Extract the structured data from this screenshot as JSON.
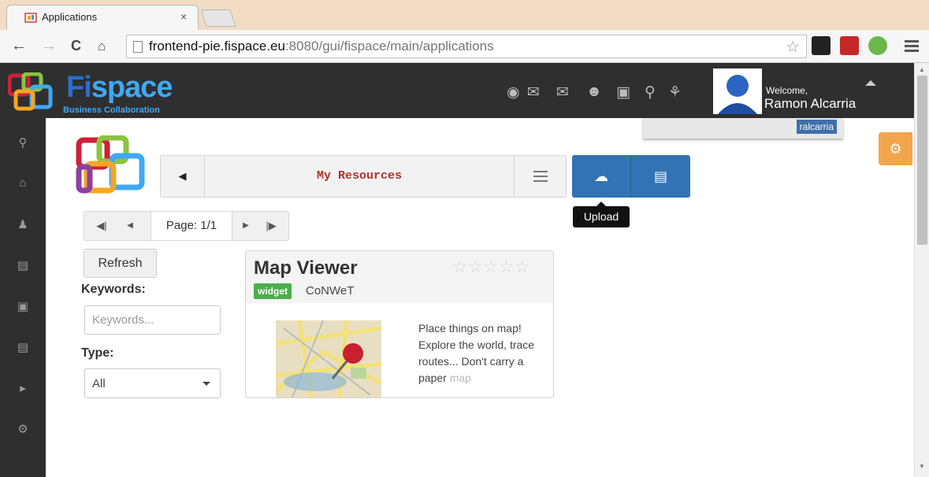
{
  "browser": {
    "tab_title": "Applications",
    "tab_close": "×",
    "url_host": "frontend-pie.fispace.eu",
    "url_path": ":8080/gui/fispace/main/applications"
  },
  "header": {
    "brand_suffix": "space",
    "brand_prefix": "Fi",
    "brand_tagline": "Business Collaboration",
    "welcome_label": "Welcome,",
    "user_name": "Ramon Alcarria",
    "username_tag": "ralcarria",
    "icons": [
      "globe-icon",
      "envelope-icon",
      "chat-icon",
      "users-icon",
      "briefcase-icon",
      "search-icon",
      "puzzle-icon"
    ]
  },
  "sidebar": {
    "icons": [
      "search-icon",
      "home-icon",
      "user-icon",
      "cart-icon",
      "inbox-icon",
      "document-icon",
      "megaphone-icon",
      "gears-icon"
    ]
  },
  "resources": {
    "title": "My Resources",
    "upload_tooltip": "Upload"
  },
  "pager": {
    "page_label": "Page: 1/1"
  },
  "filters": {
    "refresh_label": "Refresh",
    "keywords_label": "Keywords:",
    "keywords_placeholder": "Keywords...",
    "type_label": "Type:",
    "type_value": "All"
  },
  "card": {
    "title": "Map Viewer",
    "badge": "widget",
    "vendor": "CoNWeT",
    "rating_stars": 0,
    "desc_visible": "Place things on map! Explore the world, trace routes... Don't carry a paper",
    "desc_faded": "map"
  },
  "colors": {
    "header_bg": "#2f2f2f",
    "brand_blue": "#3fa9f5",
    "primary_button": "#3273b5",
    "resource_title": "#b0322a",
    "gear_button": "#f3a54d",
    "badge_green": "#4cae4c"
  }
}
